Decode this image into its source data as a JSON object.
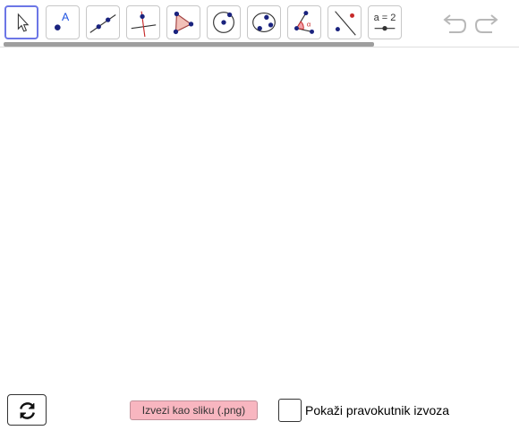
{
  "toolbar": {
    "tools": [
      {
        "name": "move-tool",
        "selected": true
      },
      {
        "name": "point-tool",
        "label": "A"
      },
      {
        "name": "line-tool"
      },
      {
        "name": "perpendicular-line-tool"
      },
      {
        "name": "polygon-tool"
      },
      {
        "name": "circle-with-center-tool"
      },
      {
        "name": "circle-through-points-tool"
      },
      {
        "name": "angle-tool",
        "label": "α"
      },
      {
        "name": "reflect-about-line-tool"
      },
      {
        "name": "slider-tool",
        "label": "a = 2"
      }
    ],
    "undo_icon": "undo-icon",
    "redo_icon": "redo-icon"
  },
  "bottom": {
    "reset_icon": "refresh-icon",
    "export_button": "Izvezi kao sliku (.png)",
    "checkbox_label": "Pokaži pravokutnik izvoza",
    "checkbox_checked": false
  },
  "colors": {
    "selected_border": "#6c76e6",
    "export_bg": "#f8b6c0",
    "point": "#1a237e",
    "accent_red": "#c62828"
  }
}
